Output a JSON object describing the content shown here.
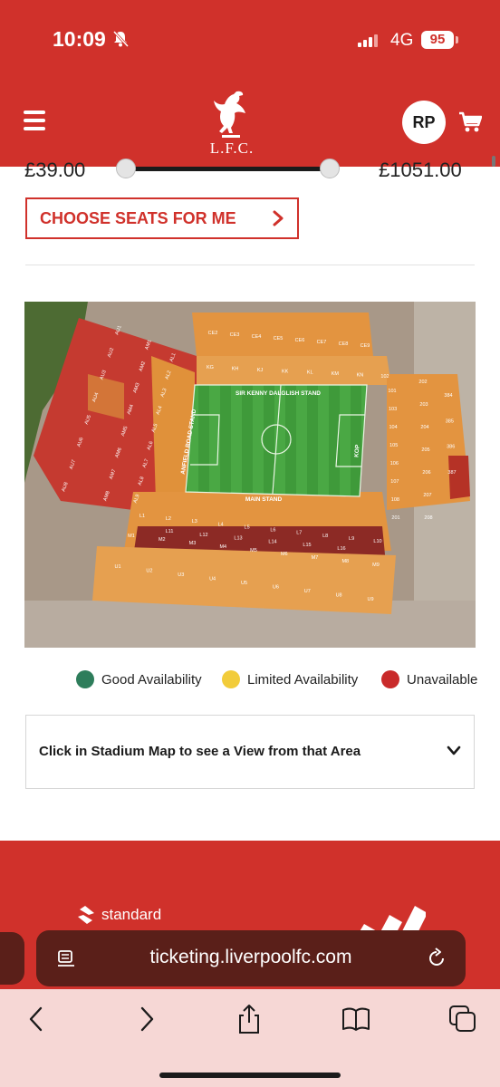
{
  "status_bar": {
    "time": "10:09",
    "network": "4G",
    "battery": "95"
  },
  "header": {
    "logo_text": "L.F.C.",
    "avatar_initials": "RP"
  },
  "price_filter": {
    "min_price": "£39.00",
    "max_price": "£1051.00"
  },
  "choose_seats": {
    "label": "CHOOSE SEATS FOR ME"
  },
  "stadium": {
    "stand_labels": {
      "north": "SIR KENNY DALGLISH STAND",
      "west": "ANFIELD ROAD STAND",
      "south": "MAIN STAND",
      "east": "KOP"
    },
    "sections": {
      "kenny_upper": [
        "CE2",
        "CE3",
        "CE4",
        "CE5",
        "CE6",
        "CE7",
        "CE8",
        "CE9"
      ],
      "kenny_lower": [
        "KG",
        "KH",
        "KJ",
        "KK",
        "KL",
        "KM",
        "KN",
        "102"
      ],
      "anfield_upper": [
        "AU1",
        "AU2",
        "AU3",
        "AU4",
        "AU5",
        "AU6",
        "AU7",
        "AU8"
      ],
      "anfield_middle": [
        "AM1",
        "AM2",
        "AM3",
        "AM4",
        "AM5",
        "AM6",
        "AM7",
        "AM8"
      ],
      "anfield_lower": [
        "AL1",
        "AL2",
        "AL3",
        "AL4",
        "AL5",
        "AL6",
        "AL7",
        "AL8",
        "AL9"
      ],
      "main_lower": [
        "L1",
        "L2",
        "L3",
        "L4",
        "L5",
        "L6",
        "L7",
        "L8",
        "L9",
        "L10"
      ],
      "main_boxes": [
        "L11",
        "L12",
        "L13",
        "L14",
        "L15",
        "L16"
      ],
      "main_middle": [
        "M1",
        "M2",
        "M3",
        "M4",
        "M5",
        "M6",
        "M7",
        "M8",
        "M9"
      ],
      "main_upper": [
        "U1",
        "U2",
        "U3",
        "U4",
        "U5",
        "U6",
        "U7",
        "U8",
        "U9"
      ],
      "kop": [
        "101",
        "103",
        "104",
        "105",
        "106",
        "107",
        "108",
        "201",
        "202",
        "203",
        "204",
        "205",
        "206",
        "207",
        "208",
        "384",
        "385",
        "386",
        "387"
      ]
    }
  },
  "legend": {
    "good": {
      "label": "Good Availability",
      "color": "#2e7d5b"
    },
    "limited": {
      "label": "Limited Availability",
      "color": "#f2cc3a"
    },
    "unavailable": {
      "label": "Unavailable",
      "color": "#c92a2a"
    }
  },
  "view_accordion": {
    "label": "Click in Stadium Map to see a View from that Area"
  },
  "footer": {
    "sponsor": "standard"
  },
  "browser": {
    "url": "ticketing.liverpoolfc.com"
  },
  "colors": {
    "brand_red": "#d0312b",
    "url_bar": "#5a1f19",
    "toolbar": "#f6d7d5"
  }
}
